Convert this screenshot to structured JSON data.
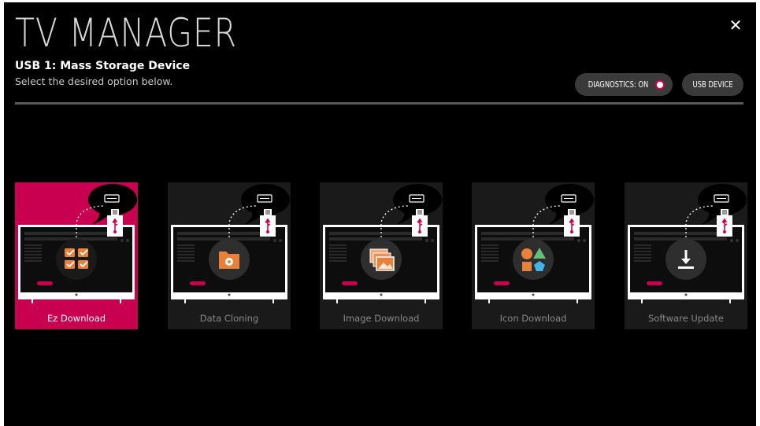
{
  "header": {
    "title": "TV MANAGER",
    "subtitle": "USB 1: Mass Storage Device",
    "instruction": "Select the desired option below."
  },
  "buttons": {
    "close_icon": "close-icon",
    "diagnostics_label": "DIAGNOSTICS: ON",
    "usb_device_label": "USB DEVICE"
  },
  "options": [
    {
      "label": "Ez Download",
      "icon": "checklist-icon",
      "selected": true
    },
    {
      "label": "Data Cloning",
      "icon": "folder-gear-icon",
      "selected": false
    },
    {
      "label": "Image Download",
      "icon": "image-stack-icon",
      "selected": false
    },
    {
      "label": "Icon Download",
      "icon": "shapes-icon",
      "selected": false
    },
    {
      "label": "Software Update",
      "icon": "download-icon",
      "selected": false
    }
  ],
  "colors": {
    "accent": "#c8004f",
    "background": "#000000",
    "card": "#1a1a1a",
    "usb_symbol": "#d8004c",
    "icon_orange": "#e8813a",
    "icon_green": "#63c07a",
    "icon_blue": "#42b4e6"
  }
}
